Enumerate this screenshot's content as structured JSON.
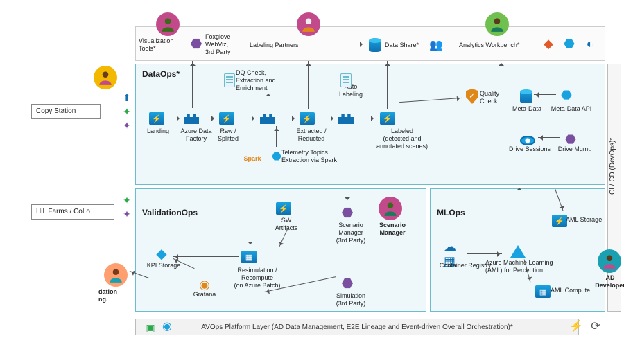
{
  "left": {
    "copy_station": "Copy Station",
    "hil_farms": "HiL Farms / CoLo",
    "validation_eng_role": "dation\nng."
  },
  "toprow": {
    "viz_tools": "Visualization\nTools*",
    "foxglove": "Foxglove\nWebViz,\n3rd Party",
    "labeling_partners": "Labeling Partners",
    "data_share": "Data Share*",
    "analytics_workbench": "Analytics Workbench*"
  },
  "dataops": {
    "title": "DataOps*",
    "landing": "Landing",
    "adf": "Azure Data\nFactory",
    "raw": "Raw /\nSplitted",
    "dq": "DQ Check,\nExtraction and\nEnrichment",
    "extracted": "Extracted /\nReducted",
    "telemetry": "Telemetry Topics\nExtraction via Spark",
    "spark": "Spark",
    "auto_label": "Auto\nLabeling",
    "labeled": "Labeled\n(detected and\nannotated scenes)",
    "quality_check": "Quality\nCheck",
    "metadata": "Meta-Data",
    "metadata_api": "Meta-Data API",
    "drive_sessions": "Drive Sessions",
    "drive_mgmt": "Drive Mgmt."
  },
  "valops": {
    "title": "ValidationOps",
    "kpi_storage": "KPI Storage",
    "grafana": "Grafana",
    "resim": "Resimulation /\nRecompute\n(on Azure Batch)",
    "sw_artifacts": "SW\nArtifacts",
    "scenario_mgr_3p": "Scenario\nManager\n(3rd Party)",
    "simulation": "Simulation\n(3rd Party)",
    "scenario_mgr_role": "Scenario\nManager"
  },
  "mlops": {
    "title": "MLOps",
    "container_registry": "Container Registry",
    "aml": "Azure Machine Learning\n(AML) for Perception",
    "aml_storage": "AML Storage",
    "aml_compute": "AML Compute"
  },
  "right": {
    "cicd": "CI / CD (DevOps)*",
    "ad_developer": "AD\nDeveloper"
  },
  "footer": {
    "text": "AVOps Platform Layer (AD Data Management, E2E Lineage and Event-driven Overall Orchestration)*"
  }
}
